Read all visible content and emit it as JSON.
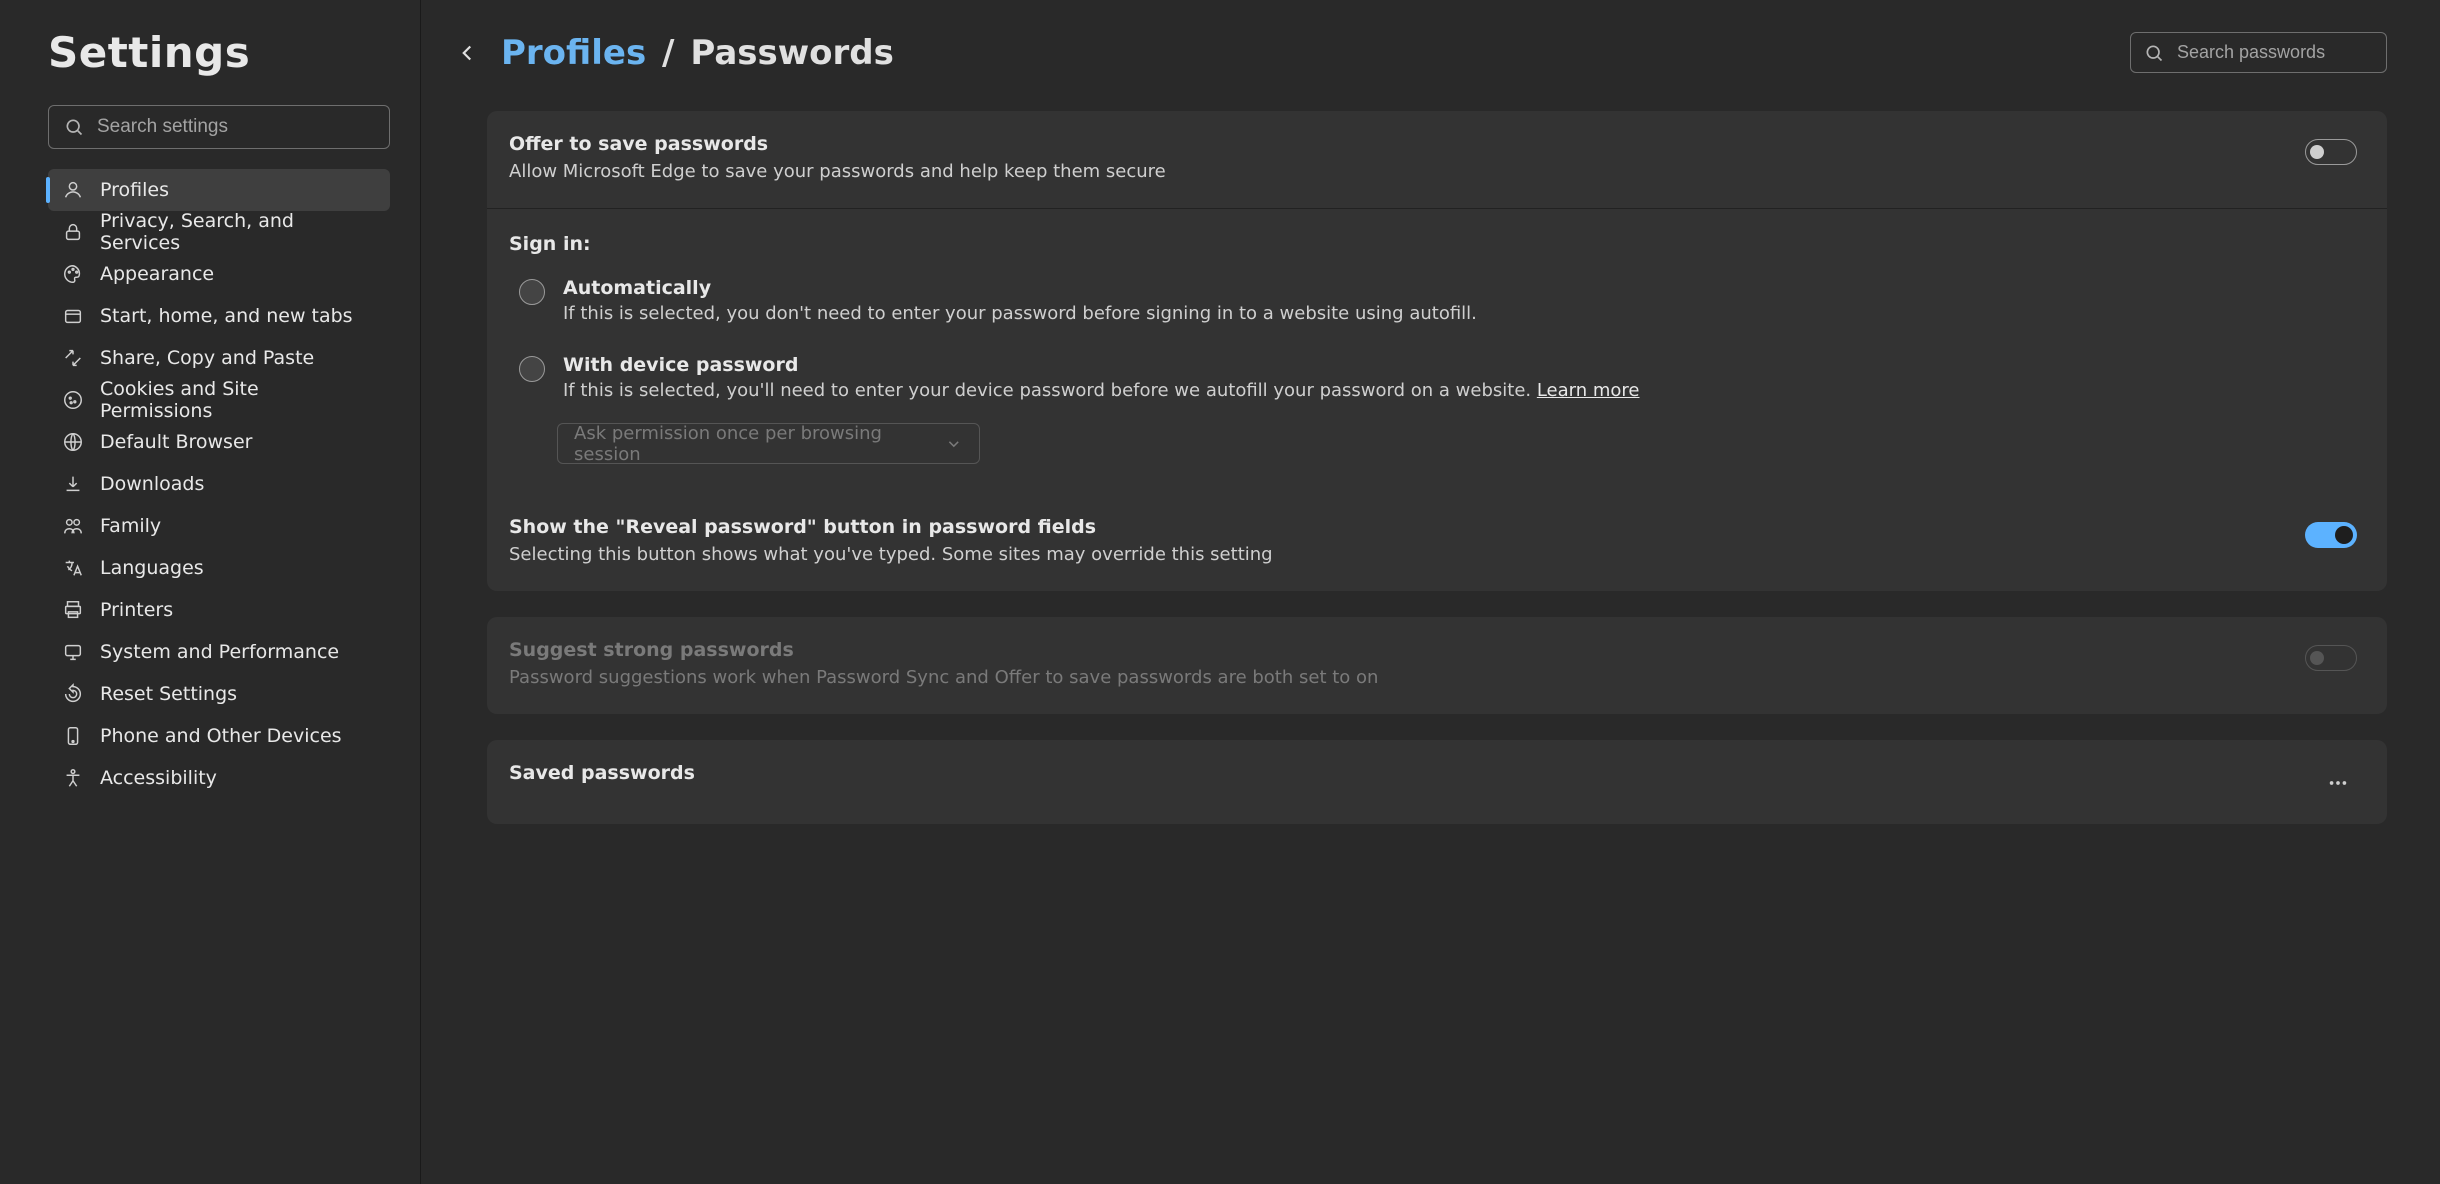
{
  "sidebar": {
    "title": "Settings",
    "search_placeholder": "Search settings",
    "items": [
      {
        "label": "Profiles",
        "active": true
      },
      {
        "label": "Privacy, Search, and Services"
      },
      {
        "label": "Appearance"
      },
      {
        "label": "Start, home, and new tabs"
      },
      {
        "label": "Share, Copy and Paste"
      },
      {
        "label": "Cookies and Site Permissions"
      },
      {
        "label": "Default Browser"
      },
      {
        "label": "Downloads"
      },
      {
        "label": "Family"
      },
      {
        "label": "Languages"
      },
      {
        "label": "Printers"
      },
      {
        "label": "System and Performance"
      },
      {
        "label": "Reset Settings"
      },
      {
        "label": "Phone and Other Devices"
      },
      {
        "label": "Accessibility"
      }
    ]
  },
  "header": {
    "breadcrumb_link": "Profiles",
    "breadcrumb_sep": "/",
    "breadcrumb_current": "Passwords",
    "search_placeholder": "Search passwords"
  },
  "offer": {
    "title": "Offer to save passwords",
    "desc": "Allow Microsoft Edge to save your passwords and help keep them secure",
    "on": false
  },
  "signin": {
    "heading": "Sign in:",
    "auto_title": "Automatically",
    "auto_desc": "If this is selected, you don't need to enter your password before signing in to a website using autofill.",
    "device_title": "With device password",
    "device_desc": "If this is selected, you'll need to enter your device password before we autofill your password on a website. ",
    "learn_more": "Learn more",
    "select_value": "Ask permission once per browsing session"
  },
  "reveal": {
    "title": "Show the \"Reveal password\" button in password fields",
    "desc": "Selecting this button shows what you've typed. Some sites may override this setting",
    "on": true
  },
  "suggest": {
    "title": "Suggest strong passwords",
    "desc": "Password suggestions work when Password Sync and Offer to save passwords are both set to on",
    "on": false,
    "disabled": true
  },
  "saved": {
    "title": "Saved passwords"
  }
}
